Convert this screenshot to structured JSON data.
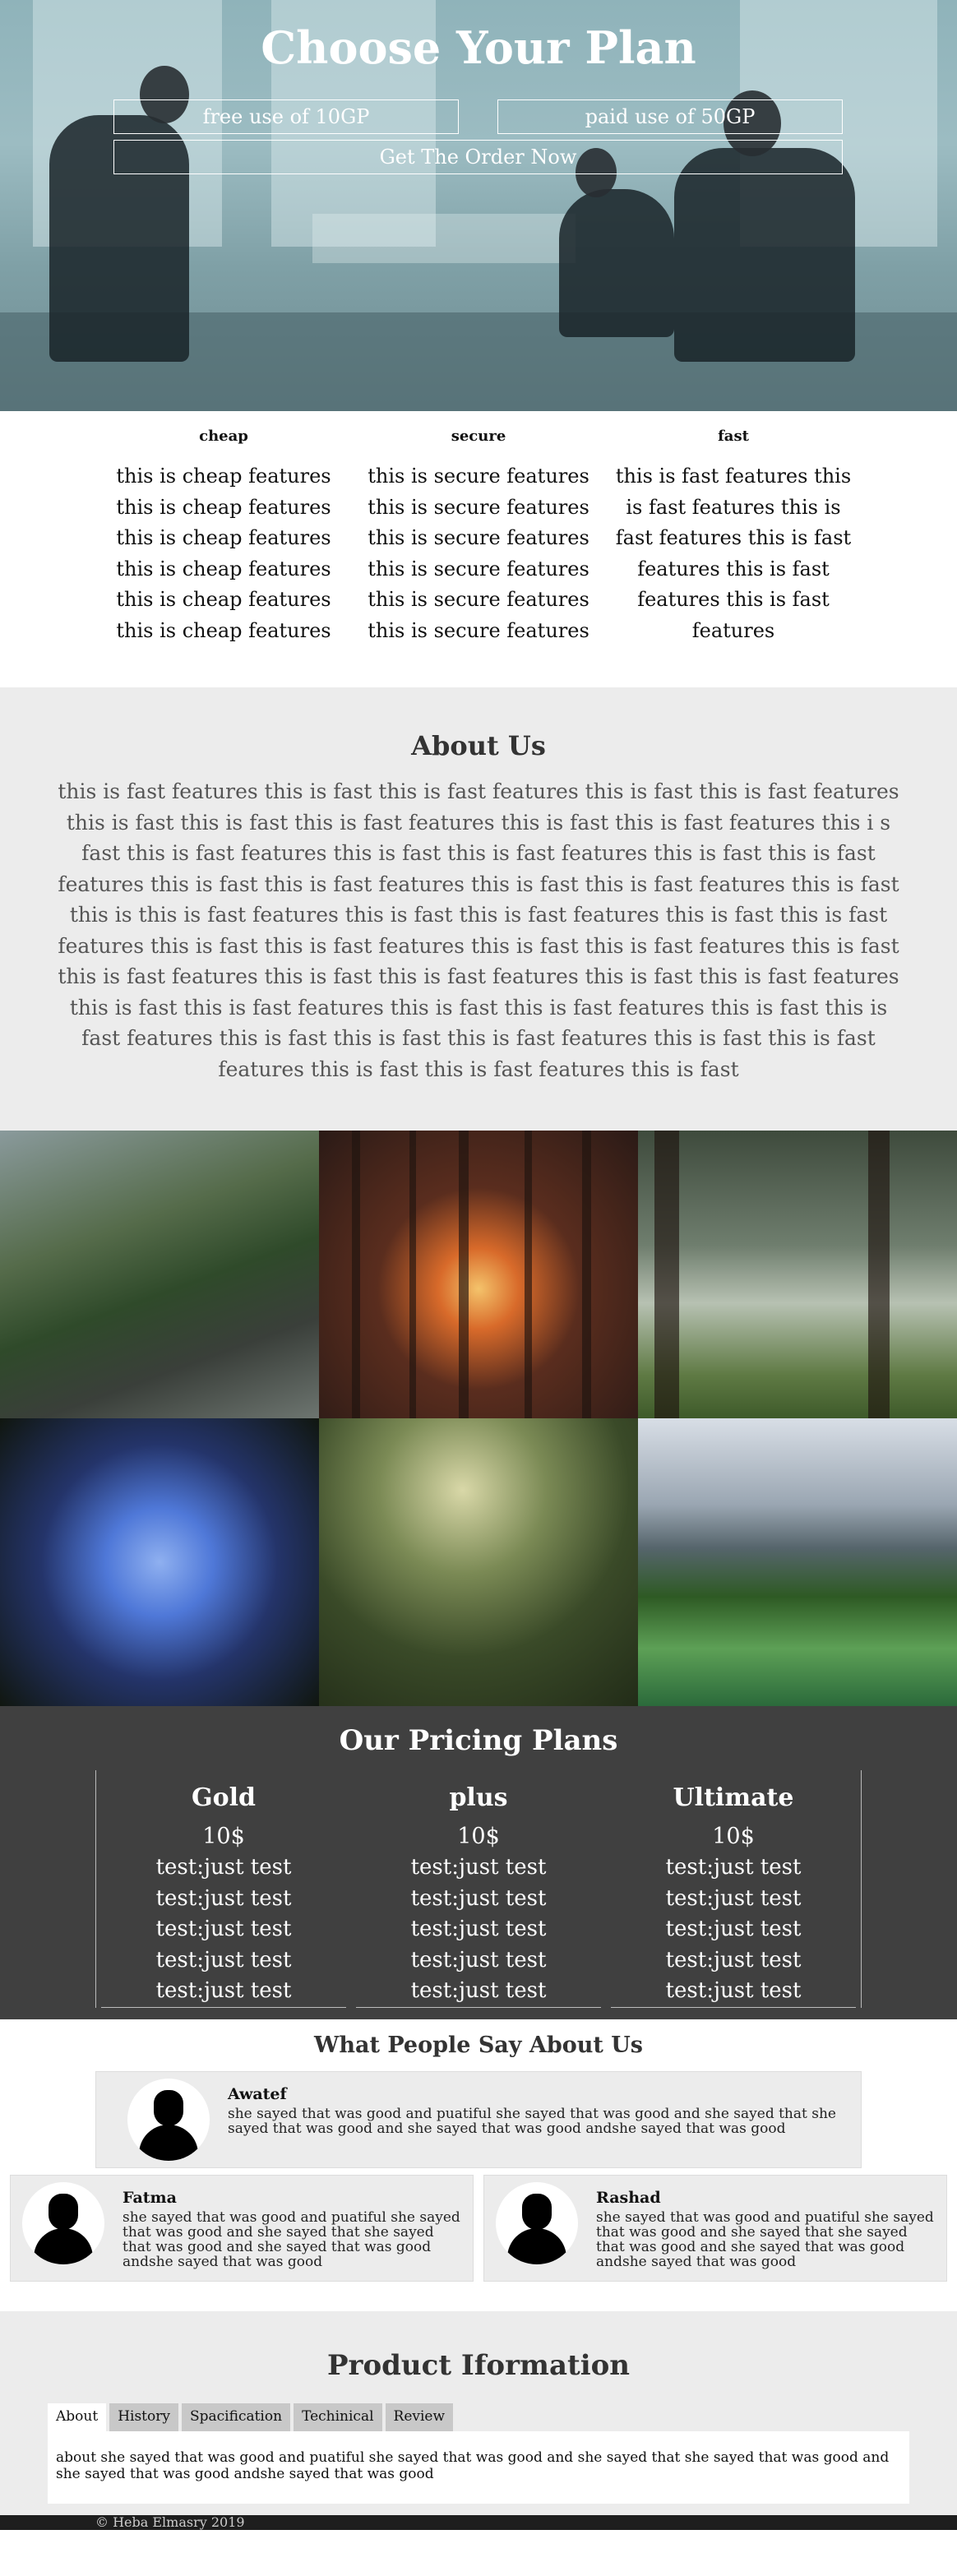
{
  "hero": {
    "title": "Choose Your Plan",
    "btn_free": "free use of 10GP",
    "btn_paid": "paid use of 50GP",
    "btn_order": "Get The Order Now"
  },
  "features": [
    {
      "title": "cheap",
      "text": "this is cheap features this is cheap features this is cheap features this is cheap features this is cheap features this is cheap features"
    },
    {
      "title": "secure",
      "text": "this is secure features this is secure features this is secure features this is secure features this is secure features this is secure features"
    },
    {
      "title": "fast",
      "text": "this is fast features this is fast features this is fast features this is fast features this is fast features this is fast features"
    }
  ],
  "about": {
    "title": "About Us",
    "text": "this is fast features this is fast this is fast features this is fast this is fast features this is fast this is fast this is fast features this is fast this is fast features this i s fast this is fast features this is fast this is fast features this is fast this is fast features this is fast this is fast features this is fast this is fast features this is fast this is this is fast features this is fast this is fast features this is fast this is fast features this is fast this is fast features this is fast this is fast features this is fast this is fast features this is fast this is fast features this is fast this is fast features this is fast this is fast features this is fast this is fast features this is fast this is fast features this is fast this is fast this is fast features this is fast this is fast features this is fast this is fast features this is fast"
  },
  "gallery": [
    "river-rocks-image",
    "forest-sunset-image",
    "old-trees-image",
    "tree-canopy-image",
    "forest-path-image",
    "mountain-lake-image"
  ],
  "pricing": {
    "title": "Our Pricing Plans",
    "plans": [
      {
        "name": "Gold",
        "price": "10$",
        "items": [
          "test:just test",
          "test:just test",
          "test:just test",
          "test:just test",
          "test:just test"
        ]
      },
      {
        "name": "plus",
        "price": "10$",
        "items": [
          "test:just test",
          "test:just test",
          "test:just test",
          "test:just test",
          "test:just test"
        ]
      },
      {
        "name": "Ultimate",
        "price": "10$",
        "items": [
          "test:just test",
          "test:just test",
          "test:just test",
          "test:just test",
          "test:just test"
        ]
      }
    ]
  },
  "testimonials": {
    "title": "What People Say About Us",
    "items": [
      {
        "name": "Awatef",
        "text": "she sayed that was good and puatiful she sayed that was good and she sayed that she sayed that was good and she sayed that was good andshe sayed that was good"
      },
      {
        "name": "Fatma",
        "text": "she sayed that was good and puatiful she sayed that was good and she sayed that she sayed that was good and she sayed that was good andshe sayed that was good"
      },
      {
        "name": "Rashad",
        "text": "she sayed that was good and puatiful she sayed that was good and she sayed that she sayed that was good and she sayed that was good andshe sayed that was good"
      }
    ]
  },
  "product": {
    "title": "Product Iformation",
    "tabs": [
      "About",
      "History",
      "Spacification",
      "Techinical",
      "Review"
    ],
    "active_tab": "About",
    "panel_text": "about she sayed that was good and puatiful she sayed that was good and she sayed that she sayed that was good and she sayed that was good andshe sayed that was good"
  },
  "footer": {
    "text": "© Heba Elmasry 2019"
  }
}
